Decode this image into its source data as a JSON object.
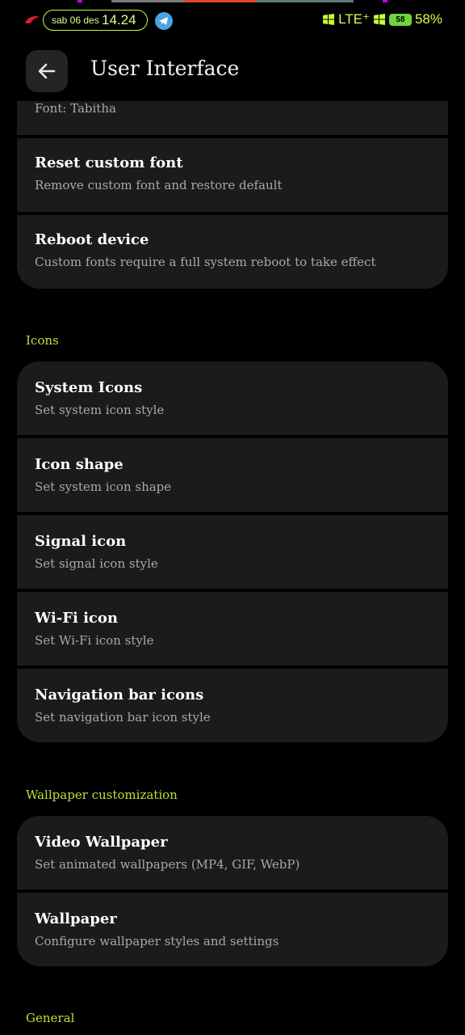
{
  "status_bar": {
    "date": "sab 06 des",
    "time": "14.24",
    "network": "LTE⁺",
    "battery_badge": "58",
    "battery_percent": "58%",
    "accent": "#c6ff3a"
  },
  "header": {
    "title": "User Interface",
    "back_icon": "arrow-left-icon"
  },
  "font_group": {
    "partial_item_subtitle": "Font: Tabitha",
    "items": [
      {
        "title": "Reset custom font",
        "subtitle": "Remove custom font and restore default"
      },
      {
        "title": "Reboot device",
        "subtitle": "Custom fonts require a full system reboot to take effect"
      }
    ]
  },
  "sections": {
    "icons": "Icons",
    "wallpaper": "Wallpaper customization",
    "general": "General"
  },
  "icons_items": [
    {
      "title": "System Icons",
      "subtitle": "Set system icon style"
    },
    {
      "title": "Icon shape",
      "subtitle": "Set system icon shape"
    },
    {
      "title": "Signal icon",
      "subtitle": "Set signal icon style"
    },
    {
      "title": "Wi-Fi icon",
      "subtitle": "Set Wi-Fi icon style"
    },
    {
      "title": "Navigation bar icons",
      "subtitle": "Set navigation bar icon style"
    }
  ],
  "wallpaper_items": [
    {
      "title": "Video Wallpaper",
      "subtitle": "Set animated wallpapers (MP4, GIF, WebP)"
    },
    {
      "title": "Wallpaper",
      "subtitle": "Configure wallpaper styles and settings"
    }
  ],
  "colors": {
    "background": "#000000",
    "card": "#1b1b1b",
    "section_accent": "#b8e23a"
  }
}
